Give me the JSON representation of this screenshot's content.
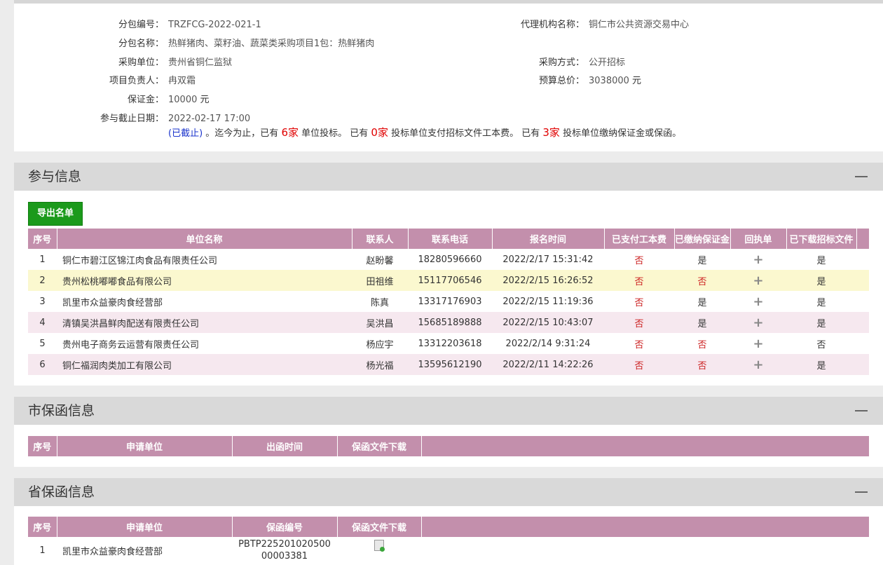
{
  "info": {
    "fields": [
      {
        "label": "分包编号：",
        "value": "TRZFCG-2022-021-1"
      },
      {
        "label": "代理机构名称：",
        "value": "铜仁市公共资源交易中心"
      },
      {
        "label": "分包名称：",
        "value": "热鲜猪肉、菜籽油、蔬菜类采购项目1包：热鲜猪肉"
      },
      {
        "label": "采购单位：",
        "value": "贵州省铜仁监狱"
      },
      {
        "label": "采购方式：",
        "value": "公开招标"
      },
      {
        "label": "项目负责人：",
        "value": "冉双霜"
      },
      {
        "label": "预算总价：",
        "value": "3038000",
        "unit": "元"
      },
      {
        "label": "保证金：",
        "value": "10000",
        "unit": "元"
      },
      {
        "label": "参与截止日期：",
        "value": "2022-02-17 17:00"
      }
    ],
    "status": {
      "closed": "(已截止)",
      "t1": "。迄今为止，已有",
      "n1": "6家",
      "t2": "单位投标。 已有",
      "n2": "0家",
      "t3": "投标单位支付招标文件工本费。 已有",
      "n3": "3家",
      "t4": "投标单位缴纳保证金或保函。"
    }
  },
  "participation": {
    "title": "参与信息",
    "export_label": "导出名单",
    "columns": [
      "序号",
      "单位名称",
      "联系人",
      "联系电话",
      "报名时间",
      "已支付工本费",
      "已缴纳保证金",
      "回执单",
      "已下载招标文件"
    ],
    "rows": [
      {
        "no": "1",
        "name": "铜仁市碧江区锦江肉食品有限责任公司",
        "contact": "赵盼馨",
        "phone": "18280596660",
        "time": "2022/2/17 15:31:42",
        "paid": "否",
        "deposit": "是",
        "receipt": "+",
        "downloaded": "是"
      },
      {
        "no": "2",
        "name": "贵州松桃嘟嘟食品有限公司",
        "contact": "田祖维",
        "phone": "15117706546",
        "time": "2022/2/15 16:26:52",
        "paid": "否",
        "deposit": "否",
        "receipt": "+",
        "downloaded": "是"
      },
      {
        "no": "3",
        "name": "凯里市众益豪肉食经营部",
        "contact": "陈真",
        "phone": "13317176903",
        "time": "2022/2/15 11:19:36",
        "paid": "否",
        "deposit": "是",
        "receipt": "+",
        "downloaded": "是"
      },
      {
        "no": "4",
        "name": "清镇吴洪昌鲜肉配送有限责任公司",
        "contact": "吴洪昌",
        "phone": "15685189888",
        "time": "2022/2/15 10:43:07",
        "paid": "否",
        "deposit": "是",
        "receipt": "+",
        "downloaded": "是"
      },
      {
        "no": "5",
        "name": "贵州电子商务云运营有限责任公司",
        "contact": "杨应宇",
        "phone": "13312203618",
        "time": "2022/2/14 9:31:24",
        "paid": "否",
        "deposit": "否",
        "receipt": "+",
        "downloaded": "否"
      },
      {
        "no": "6",
        "name": "铜仁福润肉类加工有限公司",
        "contact": "杨光福",
        "phone": "13595612190",
        "time": "2022/2/11 14:22:26",
        "paid": "否",
        "deposit": "否",
        "receipt": "+",
        "downloaded": "是"
      }
    ]
  },
  "city_guarantee": {
    "title": "市保函信息",
    "columns": [
      "序号",
      "申请单位",
      "出函时间",
      "保函文件下载"
    ]
  },
  "province_guarantee": {
    "title": "省保函信息",
    "columns": [
      "序号",
      "申请单位",
      "保函编号",
      "保函文件下载"
    ],
    "rows": [
      {
        "no": "1",
        "name": "凯里市众益豪肉食经营部",
        "code_line1": "PBTP225201020500",
        "code_line2": "00003381"
      }
    ]
  }
}
